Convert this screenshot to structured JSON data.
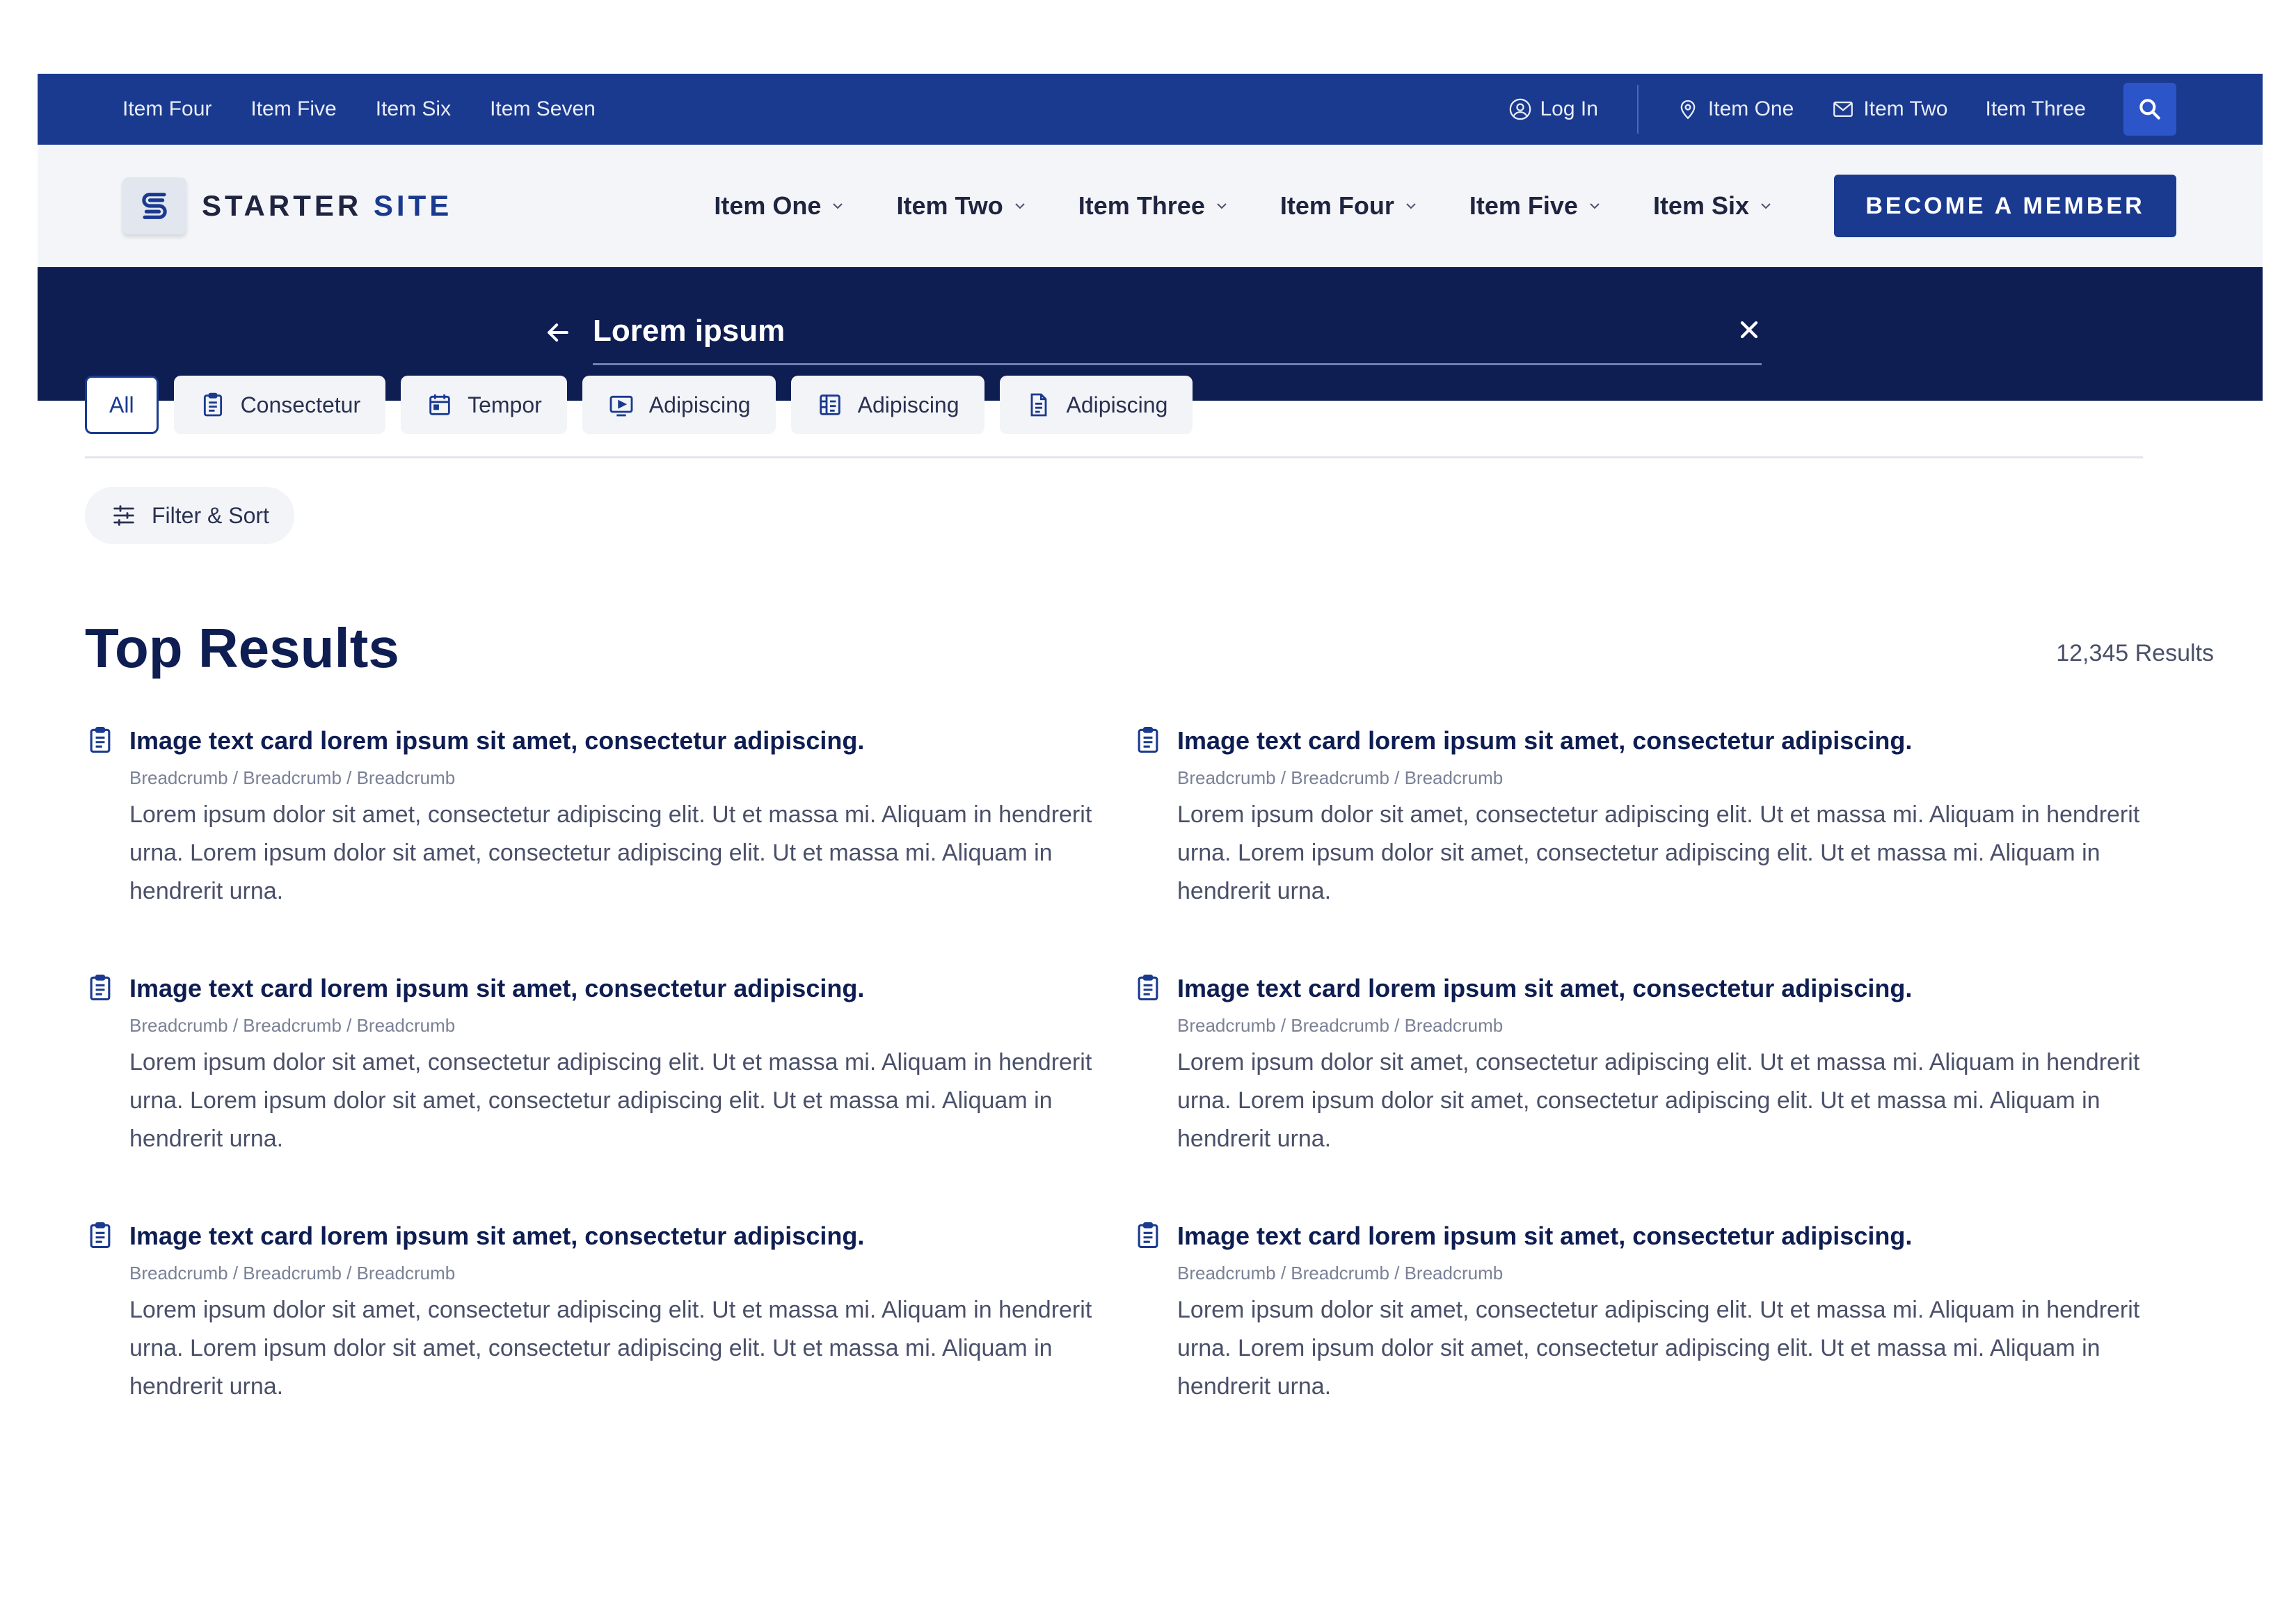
{
  "utility_bar": {
    "left_links": [
      "Item Four",
      "Item Five",
      "Item Six",
      "Item Seven"
    ],
    "login_label": "Log In",
    "location_label": "Item One",
    "mail_label": "Item Two",
    "plain_label": "Item Three"
  },
  "header": {
    "logo_word1": "STARTER",
    "logo_word2": "SITE",
    "nav_items": [
      "Item One",
      "Item Two",
      "Item Three",
      "Item Four",
      "Item Five",
      "Item Six"
    ],
    "cta_label": "BECOME A MEMBER"
  },
  "search": {
    "value": "Lorem ipsum"
  },
  "filters": {
    "chips": [
      {
        "label": "All",
        "icon": "none",
        "active": true
      },
      {
        "label": "Consectetur",
        "icon": "clipboard-icon",
        "active": false
      },
      {
        "label": "Tempor",
        "icon": "calendar-icon",
        "active": false
      },
      {
        "label": "Adipiscing",
        "icon": "video-icon",
        "active": false
      },
      {
        "label": "Adipiscing",
        "icon": "layout-icon",
        "active": false
      },
      {
        "label": "Adipiscing",
        "icon": "document-icon",
        "active": false
      }
    ],
    "filter_sort_label": "Filter & Sort"
  },
  "results": {
    "title": "Top Results",
    "count": "12,345 Results",
    "items": [
      {
        "title": "Image text card lorem ipsum sit amet, consectetur adipiscing.",
        "crumb": "Breadcrumb / Breadcrumb / Breadcrumb",
        "body": "Lorem ipsum dolor sit amet, consectetur adipiscing elit. Ut et massa mi. Aliquam in hendrerit urna. Lorem ipsum dolor sit amet, consectetur adipiscing elit. Ut et massa mi. Aliquam in hendrerit urna."
      },
      {
        "title": "Image text card lorem ipsum sit amet, consectetur adipiscing.",
        "crumb": "Breadcrumb / Breadcrumb / Breadcrumb",
        "body": "Lorem ipsum dolor sit amet, consectetur adipiscing elit. Ut et massa mi. Aliquam in hendrerit urna. Lorem ipsum dolor sit amet, consectetur adipiscing elit. Ut et massa mi. Aliquam in hendrerit urna."
      },
      {
        "title": "Image text card lorem ipsum sit amet, consectetur adipiscing.",
        "crumb": "Breadcrumb / Breadcrumb / Breadcrumb",
        "body": "Lorem ipsum dolor sit amet, consectetur adipiscing elit. Ut et massa mi. Aliquam in hendrerit urna. Lorem ipsum dolor sit amet, consectetur adipiscing elit. Ut et massa mi. Aliquam in hendrerit urna."
      },
      {
        "title": "Image text card lorem ipsum sit amet, consectetur adipiscing.",
        "crumb": "Breadcrumb / Breadcrumb / Breadcrumb",
        "body": "Lorem ipsum dolor sit amet, consectetur adipiscing elit. Ut et massa mi. Aliquam in hendrerit urna. Lorem ipsum dolor sit amet, consectetur adipiscing elit. Ut et massa mi. Aliquam in hendrerit urna."
      },
      {
        "title": "Image text card lorem ipsum sit amet, consectetur adipiscing.",
        "crumb": "Breadcrumb / Breadcrumb / Breadcrumb",
        "body": "Lorem ipsum dolor sit amet, consectetur adipiscing elit. Ut et massa mi. Aliquam in hendrerit urna. Lorem ipsum dolor sit amet, consectetur adipiscing elit. Ut et massa mi. Aliquam in hendrerit urna."
      },
      {
        "title": "Image text card lorem ipsum sit amet, consectetur adipiscing.",
        "crumb": "Breadcrumb / Breadcrumb / Breadcrumb",
        "body": "Lorem ipsum dolor sit amet, consectetur adipiscing elit. Ut et massa mi. Aliquam in hendrerit urna. Lorem ipsum dolor sit amet, consectetur adipiscing elit. Ut et massa mi. Aliquam in hendrerit urna."
      }
    ]
  },
  "colors": {
    "utility_bar": "#1a3a8f",
    "search_band": "#0e1d52",
    "accent": "#1a3a8f",
    "header_bg": "#f3f5f9"
  }
}
